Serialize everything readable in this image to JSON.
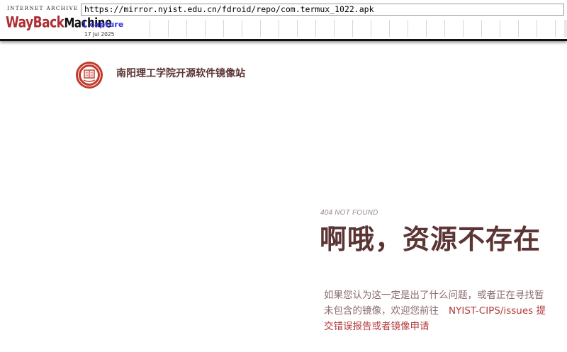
{
  "wayback": {
    "logo_top": "INTERNET ARCHIVE",
    "logo_red": "WayBack",
    "logo_black": "Machine",
    "url": "https://mirror.nyist.edu.cn/fdroid/repo/com.termux_1022.apk",
    "captures": "1 capture",
    "date": "17 Jul 2025"
  },
  "site": {
    "title": "南阳理工学院开源软件镜像站",
    "logo_icon": "university-seal-icon"
  },
  "error": {
    "code": "404 NOT FOUND",
    "title": "啊哦，资源不存在",
    "line1": "如果您认为这一定是出了什么问题，或者正在寻找暂",
    "line2_pre": "未包含的镜像，欢迎您前往",
    "link": "NYIST-CIPS/issues",
    "line2_post": "提",
    "line3": "交错误报告或者镜像申请"
  },
  "colors": {
    "brand": "#5c3434",
    "link": "#b33a3a",
    "wayback_red": "#ab2e33"
  }
}
